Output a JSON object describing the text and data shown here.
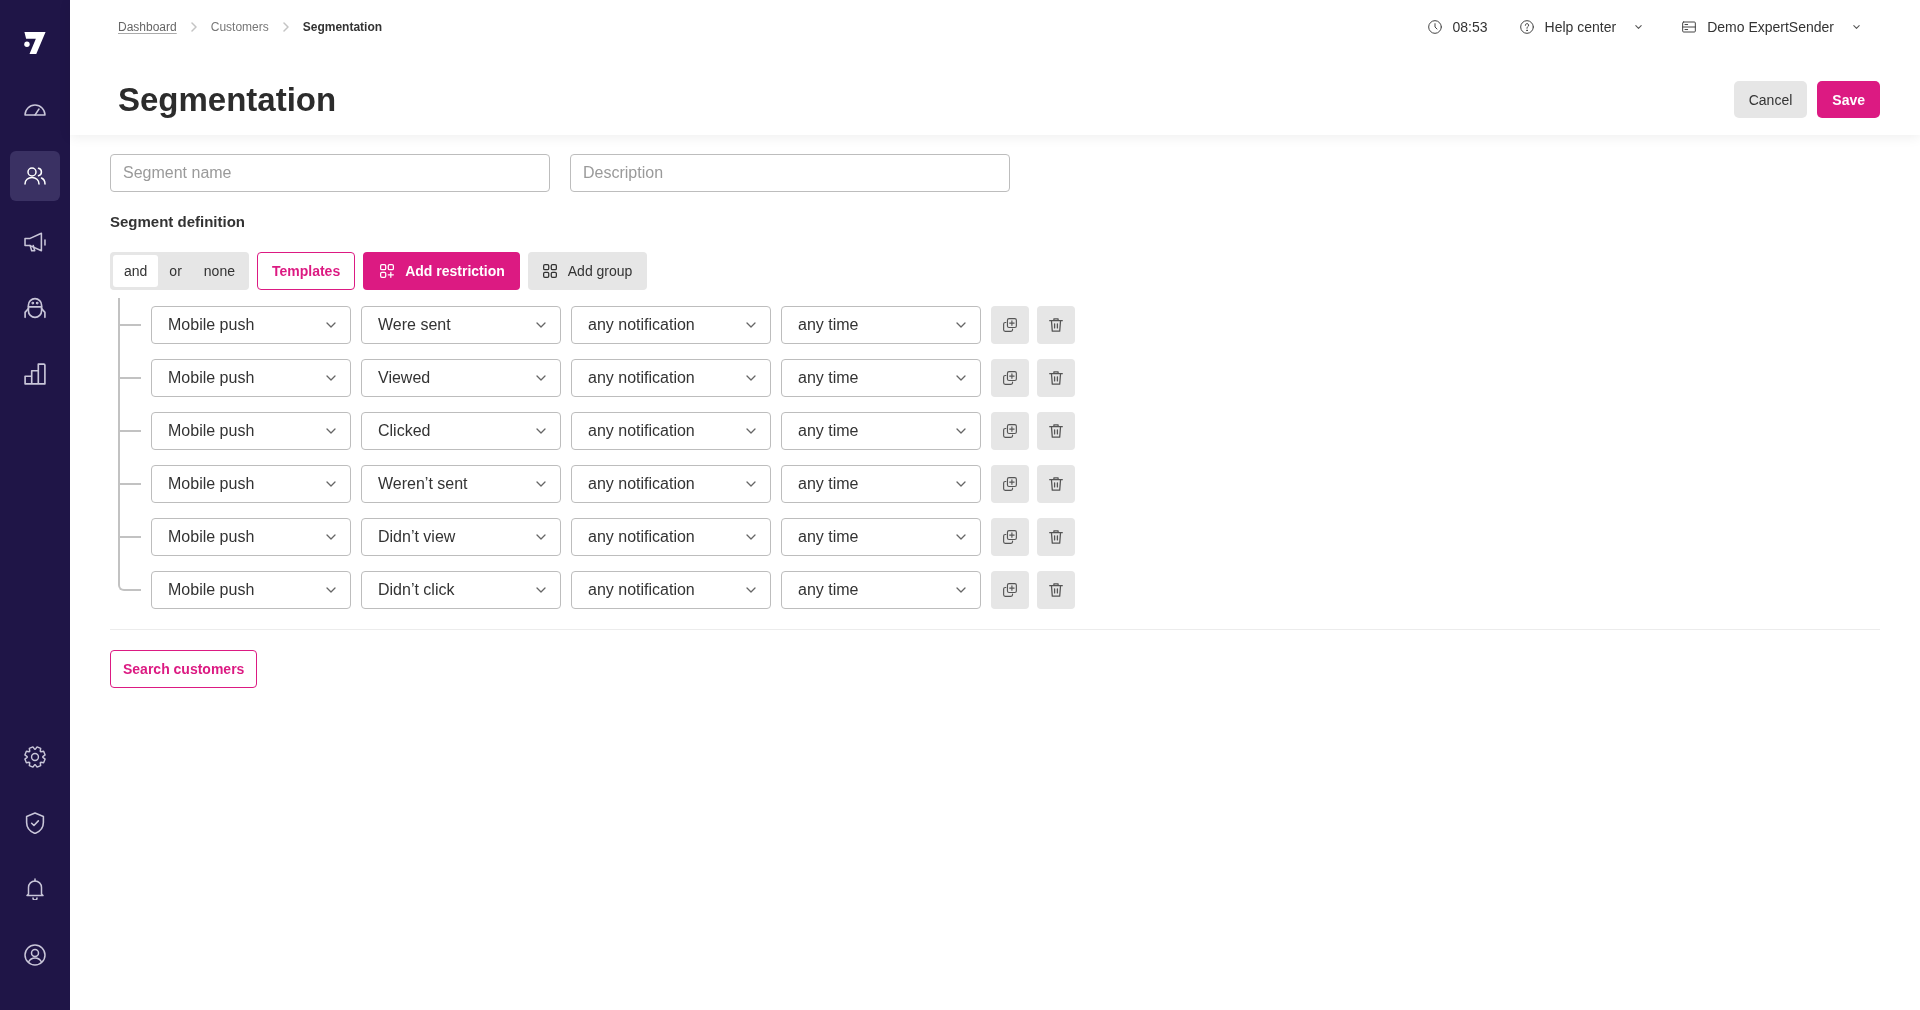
{
  "sidebar": {
    "nav_items": [
      {
        "selected": false
      },
      {
        "selected": true
      },
      {
        "selected": false
      },
      {
        "selected": false
      },
      {
        "selected": false
      }
    ],
    "footer_items": [
      {
        "selected": false
      },
      {
        "selected": false
      },
      {
        "selected": false
      },
      {
        "selected": false
      }
    ]
  },
  "breadcrumb": [
    {
      "label": "Dashboard",
      "kind": "link"
    },
    {
      "label": "Customers",
      "kind": "plain"
    },
    {
      "label": "Segmentation",
      "kind": "current"
    }
  ],
  "top_bar": {
    "time": "08:53",
    "help_menu": "Help center",
    "account_menu": "Demo ExpertSender"
  },
  "page": {
    "title": "Segmentation",
    "buttons": [
      {
        "label": "Cancel",
        "kind": "secondary"
      },
      {
        "label": "Save",
        "kind": "primary"
      }
    ]
  },
  "fields": [
    {
      "placeholder": "Segment name"
    },
    {
      "placeholder": "Description"
    }
  ],
  "segment_definition": {
    "heading": "Segment definition",
    "operators": [
      {
        "label": "and",
        "selected": true
      },
      {
        "label": "or",
        "selected": false
      },
      {
        "label": "none",
        "selected": false
      }
    ],
    "actions": [
      {
        "label": "Templates",
        "kind": "outline"
      },
      {
        "label": "Add restriction",
        "kind": "primary"
      },
      {
        "label": "Add group",
        "kind": "secondary"
      }
    ],
    "restrictions": [
      {
        "channel": "Mobile push",
        "action": "Were sent",
        "notification": "any notification",
        "period": "any time"
      },
      {
        "channel": "Mobile push",
        "action": "Viewed",
        "notification": "any notification",
        "period": "any time"
      },
      {
        "channel": "Mobile push",
        "action": "Clicked",
        "notification": "any notification",
        "period": "any time"
      },
      {
        "channel": "Mobile push",
        "action": "Weren’t sent",
        "notification": "any notification",
        "period": "any time"
      },
      {
        "channel": "Mobile push",
        "action": "Didn’t view",
        "notification": "any notification",
        "period": "any time"
      },
      {
        "channel": "Mobile push",
        "action": "Didn’t click",
        "notification": "any notification",
        "period": "any time"
      }
    ]
  },
  "search_button": "Search customers"
}
